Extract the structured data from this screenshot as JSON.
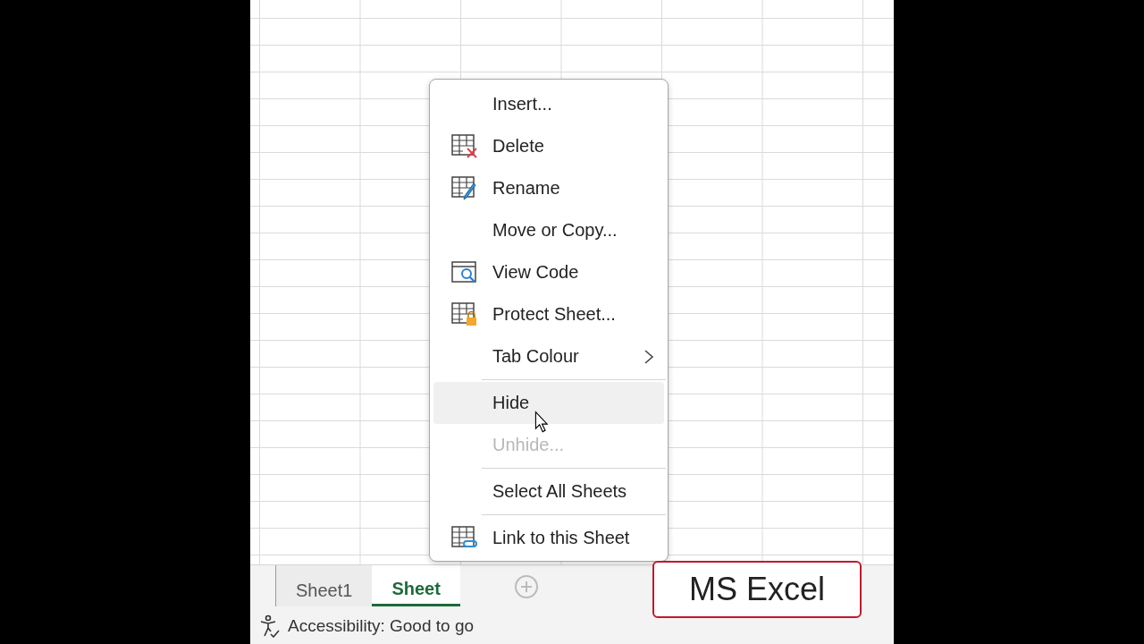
{
  "context_menu": {
    "items": [
      {
        "kind": "plain",
        "label": "Insert...",
        "selected": false,
        "disabled": false,
        "submenu": false
      },
      {
        "kind": "delete",
        "label": "Delete",
        "selected": false,
        "disabled": false,
        "submenu": false
      },
      {
        "kind": "rename",
        "label": "Rename",
        "selected": false,
        "disabled": false,
        "submenu": false
      },
      {
        "kind": "plain",
        "label": "Move or Copy...",
        "selected": false,
        "disabled": false,
        "submenu": false
      },
      {
        "kind": "code",
        "label": "View Code",
        "selected": false,
        "disabled": false,
        "submenu": false
      },
      {
        "kind": "protect",
        "label": "Protect Sheet...",
        "selected": false,
        "disabled": false,
        "submenu": false
      },
      {
        "kind": "plain",
        "label": "Tab Colour",
        "selected": false,
        "disabled": false,
        "submenu": true
      },
      {
        "kind": "separator"
      },
      {
        "kind": "plain",
        "label": "Hide",
        "selected": true,
        "disabled": false,
        "submenu": false
      },
      {
        "kind": "plain",
        "label": "Unhide...",
        "selected": false,
        "disabled": true,
        "submenu": false
      },
      {
        "kind": "separator"
      },
      {
        "kind": "plain",
        "label": "Select All Sheets",
        "selected": false,
        "disabled": false,
        "submenu": false
      },
      {
        "kind": "separator"
      },
      {
        "kind": "link",
        "label": "Link to this Sheet",
        "selected": false,
        "disabled": false,
        "submenu": false
      }
    ]
  },
  "sheet_tabs": [
    {
      "label": "Sheet1",
      "selected": false
    },
    {
      "label": "Sheet",
      "selected": true
    }
  ],
  "status_bar": {
    "text": "Accessibility: Good to go"
  },
  "caption": "MS Excel"
}
